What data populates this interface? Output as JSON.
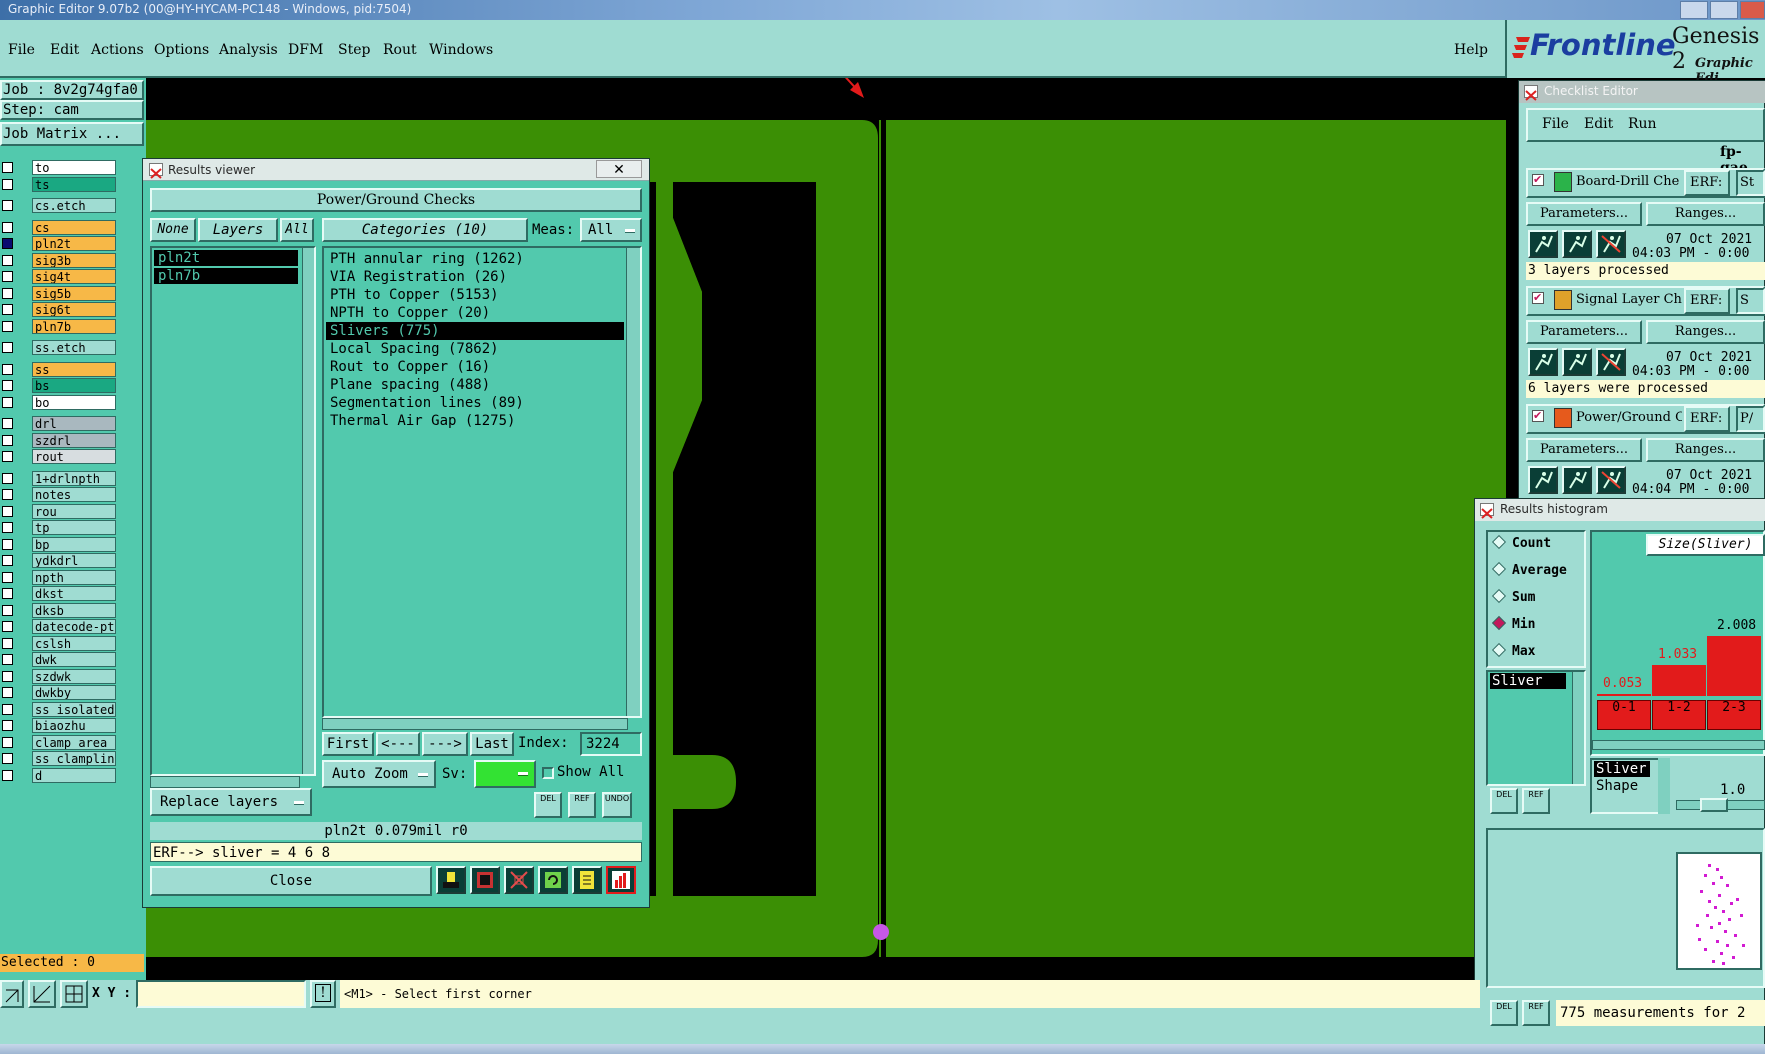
{
  "window": {
    "title": "Graphic Editor 9.07b2 (00@HY-HYCAM-PC148 - Windows, pid:7504)"
  },
  "menu": {
    "file": "File",
    "edit": "Edit",
    "actions": "Actions",
    "options": "Options",
    "analysis": "Analysis",
    "dfm": "DFM",
    "step": "Step",
    "rout": "Rout",
    "windows": "Windows",
    "help": "Help"
  },
  "brand": {
    "logo": "Frontline",
    "product": "Genesis 2",
    "subtitle": "Graphic Edi"
  },
  "left": {
    "job": "Job : 8v2g74gfa0",
    "step": "Step: cam",
    "job_matrix": "Job Matrix ...",
    "selected": "Selected : 0",
    "layers": [
      {
        "name": "to",
        "color": "#ffffff"
      },
      {
        "name": "ts",
        "color": "#1aa882"
      },
      {
        "name": "cs.etch",
        "color": "#9fdcd2",
        "gap": true
      },
      {
        "name": "cs",
        "color": "#f7b847",
        "gap": true
      },
      {
        "name": "pln2t",
        "color": "#f7b847",
        "selected": true
      },
      {
        "name": "sig3b",
        "color": "#f7b847"
      },
      {
        "name": "sig4t",
        "color": "#f7b847"
      },
      {
        "name": "sig5b",
        "color": "#f7b847"
      },
      {
        "name": "sig6t",
        "color": "#f7b847"
      },
      {
        "name": "pln7b",
        "color": "#f7b847"
      },
      {
        "name": "ss.etch",
        "color": "#9fdcd2",
        "gap": true
      },
      {
        "name": "ss",
        "color": "#f7b847",
        "gap": true
      },
      {
        "name": "bs",
        "color": "#1aa882"
      },
      {
        "name": "bo",
        "color": "#ffffff"
      },
      {
        "name": "drl",
        "color": "#a9b8bf",
        "gap": true
      },
      {
        "name": "szdrl",
        "color": "#a9b8bf"
      },
      {
        "name": "rout",
        "color": "#d7dde0"
      },
      {
        "name": "1+drlnpth",
        "color": "#9fdcd2",
        "gap": true
      },
      {
        "name": "notes",
        "color": "#9fdcd2"
      },
      {
        "name": "rou",
        "color": "#9fdcd2"
      },
      {
        "name": "tp",
        "color": "#9fdcd2"
      },
      {
        "name": "bp",
        "color": "#9fdcd2"
      },
      {
        "name": "ydkdrl",
        "color": "#9fdcd2"
      },
      {
        "name": "npth",
        "color": "#9fdcd2"
      },
      {
        "name": "dkst",
        "color": "#9fdcd2"
      },
      {
        "name": "dksb",
        "color": "#9fdcd2"
      },
      {
        "name": "datecode-pth",
        "color": "#9fdcd2"
      },
      {
        "name": "cslsh",
        "color": "#9fdcd2"
      },
      {
        "name": "dwk",
        "color": "#9fdcd2"
      },
      {
        "name": "szdwk",
        "color": "#9fdcd2"
      },
      {
        "name": "dwkby",
        "color": "#9fdcd2"
      },
      {
        "name": "ss_isolated",
        "color": "#9fdcd2"
      },
      {
        "name": "biaozhu",
        "color": "#9fdcd2"
      },
      {
        "name": "clamp_area",
        "color": "#9fdcd2"
      },
      {
        "name": "ss_clampline",
        "color": "#9fdcd2"
      },
      {
        "name": "d",
        "color": "#9fdcd2"
      }
    ]
  },
  "results_viewer": {
    "title": "Results viewer",
    "header": "Power/Ground Checks",
    "none": "None",
    "layers": "Layers",
    "all": "All",
    "categories": "Categories (10)",
    "meas_label": "Meas:",
    "meas_value": "All",
    "layer_list": [
      "pln2t",
      "pln7b"
    ],
    "category_list": [
      "PTH annular ring (1262)",
      "VIA Registration (26)",
      "PTH to Copper (5153)",
      "NPTH to Copper (20)",
      "Slivers (775)",
      "Local Spacing (7862)",
      "Rout to Copper (16)",
      "Plane spacing (488)",
      "Segmentation lines (89)",
      "Thermal Air Gap (1275)"
    ],
    "selected_category": 4,
    "first": "First",
    "prev": "<---",
    "next": "--->",
    "last": "Last",
    "index_label": "Index:",
    "index_value": "3224",
    "auto_zoom": "Auto Zoom",
    "sv_label": "Sv:",
    "show_all": "Show All",
    "replace_layers": "Replace layers",
    "del": "DEL",
    "ref": "REF",
    "undo": "UNDO",
    "status": "pln2t 0.079mil  r0",
    "erf": "ERF--> sliver = 4 6 8",
    "close": "Close"
  },
  "checklist": {
    "title": "Checklist Editor",
    "file": "File",
    "edit": "Edit",
    "run": "Run",
    "name": "fp-qae",
    "params": "Parameters...",
    "ranges": "Ranges...",
    "erf": "ERF:",
    "items": [
      {
        "name": "Board-Drill Che",
        "date": "07 Oct 2021",
        "time": "04:03 PM - 0:00",
        "msg": "3 layers processed",
        "code": "St"
      },
      {
        "name": "Signal Layer Ch",
        "date": "07 Oct 2021",
        "time": "04:03 PM - 0:00",
        "msg": "6 layers were processed",
        "code": "S"
      },
      {
        "name": "Power/Ground C",
        "date": "07 Oct 2021",
        "time": "04:04 PM - 0:00",
        "msg": "",
        "code": "P/"
      }
    ]
  },
  "histogram": {
    "title": "Results histogram",
    "options": [
      "Count",
      "Average",
      "Sum",
      "Min",
      "Max"
    ],
    "selected_option": "Min",
    "size_label": "Size(Sliver)",
    "list_item": "Sliver",
    "bars": [
      {
        "range": "0-1",
        "value": "0.053",
        "height": 0.026
      },
      {
        "range": "1-2",
        "value": "1.033",
        "height": 0.514
      },
      {
        "range": "2-3",
        "value": "2.008",
        "height": 1.0
      }
    ],
    "shape_sel": "Sliver",
    "shape_label": "Shape",
    "slider_value": "1.0",
    "footer": "775 measurements for 2",
    "del": "DEL",
    "ref": "REF"
  },
  "bottom": {
    "xy_label": "X Y :",
    "xy_value": "",
    "prompt": "<M1> - Select first corner"
  },
  "colors": {
    "panel": "#9fdcd2",
    "panel_dark": "#52c9ad",
    "copper": "#3b8f05",
    "accent_red": "#e21b1b"
  }
}
